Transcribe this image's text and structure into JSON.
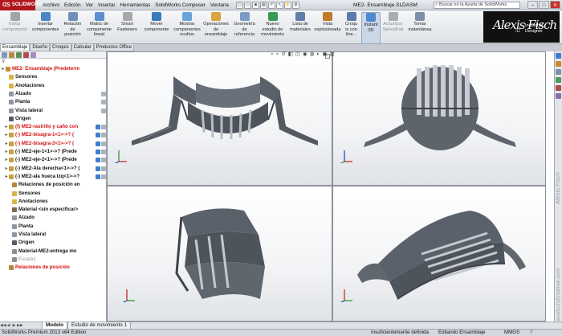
{
  "app": {
    "logo_text": "SOLIDWORKS",
    "doc_title": "ME2- Ensamblaje.SLDASM",
    "help_search_placeholder": "Buscar en la Ayuda de SolidWorks",
    "help_search_icon": "search-icon"
  },
  "menu": [
    "Archivo",
    "Edición",
    "Ver",
    "Insertar",
    "Herramientas",
    "SolidWorks Composer",
    "Ventana"
  ],
  "ribbon": [
    {
      "label": "Editar\ncomponente",
      "icon": "edit-component-icon",
      "state": "disabled",
      "color": "#9ea4ab"
    },
    {
      "label": "Insertar\ncomponentes",
      "icon": "insert-components-icon",
      "state": "normal",
      "color": "#4a86c8"
    },
    {
      "label": "Relación\nde\nposición",
      "icon": "mate-icon",
      "state": "normal",
      "color": "#6f8fb8"
    },
    {
      "label": "Matriz de\ncomponente\nlineal",
      "icon": "linear-pattern-icon",
      "state": "normal",
      "color": "#5c8fcc"
    },
    {
      "label": "Smart\nFasteners",
      "icon": "smart-fasteners-icon",
      "state": "normal",
      "color": "#a8a8a8"
    },
    {
      "label": "Mover\ncomponente",
      "icon": "move-component-icon",
      "state": "normal",
      "color": "#3b7ac0"
    },
    {
      "label": "Mostrar\ncomponentes\nocultos",
      "icon": "show-hidden-icon",
      "state": "normal",
      "color": "#6aa4d8"
    },
    {
      "label": "Operaciones\nde\nensamblaje",
      "icon": "assembly-features-icon",
      "state": "normal",
      "color": "#d9a441"
    },
    {
      "label": "Geometría\nde\nreferencia",
      "icon": "reference-geometry-icon",
      "state": "normal",
      "color": "#7a9bc4"
    },
    {
      "label": "Nuevo\nestudio de\nmovimiento",
      "icon": "motion-study-icon",
      "state": "normal",
      "color": "#3a9a55"
    },
    {
      "label": "Lista de\nmateriales",
      "icon": "bom-icon",
      "state": "normal",
      "color": "#5f7fa8"
    },
    {
      "label": "Vista\nexplosionada",
      "icon": "exploded-view-icon",
      "state": "normal",
      "color": "#c07a2a"
    },
    {
      "label": "Croqu\nis con\nlíne...",
      "icon": "explode-line-sketch-icon",
      "state": "normal",
      "color": "#5a7cae"
    },
    {
      "label": "Instant\n3D",
      "icon": "instant3d-icon",
      "state": "active",
      "color": "#4e8ad0"
    },
    {
      "label": "Actualizar\nSpeedPak",
      "icon": "speedpak-icon",
      "state": "disabled",
      "color": "#a8adb4"
    },
    {
      "label": "Tomar\ninstantánea",
      "icon": "snapshot-icon",
      "state": "normal",
      "color": "#7b8fa8"
    }
  ],
  "brand": {
    "mark": "Alexis Fisch",
    "id": "ID",
    "line1": "Industrial",
    "line2": "Designer"
  },
  "command_tabs": [
    "Ensamblaje",
    "Diseño",
    "Croquis",
    "Calcular",
    "Productos Office"
  ],
  "command_tab_active": 0,
  "tree": [
    {
      "label": "ME2- Ensamblaje  (Predeterm",
      "level": 0,
      "style": "err",
      "icon": "assembly-icon",
      "flags": []
    },
    {
      "label": "Sensores",
      "level": 1,
      "style": "bold",
      "icon": "sensors-folder-icon",
      "flags": []
    },
    {
      "label": "Anotaciones",
      "level": 1,
      "style": "bold",
      "icon": "annotations-icon",
      "flags": []
    },
    {
      "label": "Alzado",
      "level": 1,
      "style": "bold",
      "icon": "plane-icon",
      "flags": [
        "hide"
      ]
    },
    {
      "label": "Planta",
      "level": 1,
      "style": "bold",
      "icon": "plane-icon",
      "flags": [
        "hide"
      ]
    },
    {
      "label": "Vista lateral",
      "level": 1,
      "style": "bold",
      "icon": "plane-icon",
      "flags": [
        "hide"
      ]
    },
    {
      "label": "Origen",
      "level": 1,
      "style": "bold",
      "icon": "origin-icon",
      "flags": []
    },
    {
      "label": "(f) ME2-rastrillo y caño con",
      "level": 1,
      "style": "err",
      "icon": "part-icon",
      "flags": [
        "cfg",
        "hide"
      ]
    },
    {
      "label": "(-) ME2-bisagra-1<1>->? (",
      "level": 1,
      "style": "err",
      "icon": "part-icon",
      "flags": [
        "cfg",
        "hide"
      ]
    },
    {
      "label": "(-) ME2-bisagra-2<1>->? (",
      "level": 1,
      "style": "err",
      "icon": "part-icon",
      "flags": [
        "cfg",
        "hide"
      ]
    },
    {
      "label": "(-) ME2-eje-1<1>->? (Prede",
      "level": 1,
      "style": "bold",
      "icon": "part-icon",
      "flags": [
        "cfg",
        "hide"
      ]
    },
    {
      "label": "(-) ME2-eje-2<1>->? (Prede",
      "level": 1,
      "style": "bold",
      "icon": "part-icon",
      "flags": [
        "cfg",
        "hide"
      ]
    },
    {
      "label": "(-) ME2-Ala derecha<1>->? (",
      "level": 1,
      "style": "bold",
      "icon": "part-icon",
      "flags": [
        "cfg",
        "hide"
      ]
    },
    {
      "label": "(-) ME2-ala hueca Izq<1>->?",
      "level": 1,
      "style": "bold",
      "icon": "part-icon",
      "flags": [
        "cfg",
        "hide"
      ]
    },
    {
      "label": "Relaciones de posición en",
      "level": 2,
      "style": "bold",
      "icon": "mates-icon",
      "flags": []
    },
    {
      "label": "Sensores",
      "level": 2,
      "style": "bold",
      "icon": "sensors-folder-icon",
      "flags": []
    },
    {
      "label": "Anotaciones",
      "level": 2,
      "style": "bold",
      "icon": "annotations-icon",
      "flags": []
    },
    {
      "label": "Material <sin especificar>",
      "level": 2,
      "style": "bold",
      "icon": "material-icon",
      "flags": []
    },
    {
      "label": "Alzado",
      "level": 2,
      "style": "bold",
      "icon": "plane-icon",
      "flags": []
    },
    {
      "label": "Planta",
      "level": 2,
      "style": "bold",
      "icon": "plane-icon",
      "flags": []
    },
    {
      "label": "Vista lateral",
      "level": 2,
      "style": "bold",
      "icon": "plane-icon",
      "flags": []
    },
    {
      "label": "Origen",
      "level": 2,
      "style": "bold",
      "icon": "origin-icon",
      "flags": []
    },
    {
      "label": "Material-ME2-entrega mo",
      "level": 2,
      "style": "bold",
      "icon": "feature-icon",
      "flags": []
    },
    {
      "label": "Escala1",
      "level": 2,
      "style": "dim",
      "icon": "feature-icon",
      "flags": []
    },
    {
      "label": "Relaciones de posición",
      "level": 1,
      "style": "err",
      "icon": "mates-icon",
      "flags": []
    }
  ],
  "bottom_tabs": [
    "Modelo",
    "Estudio de movimiento 1"
  ],
  "bottom_tab_active": 0,
  "status": {
    "left": "SolidWorks Premium 2013 x64 Edition",
    "definition": "Insuficientemente definida",
    "mode": "Editando Ensamblaje",
    "units": "MMGS",
    "help": "?"
  },
  "watermark": {
    "name": "Alexis Fisch",
    "email": "saxafisch@hotmail.com"
  },
  "colors": {
    "error": "#d01010",
    "accent": "#b0161c",
    "model": "#4e545c"
  }
}
